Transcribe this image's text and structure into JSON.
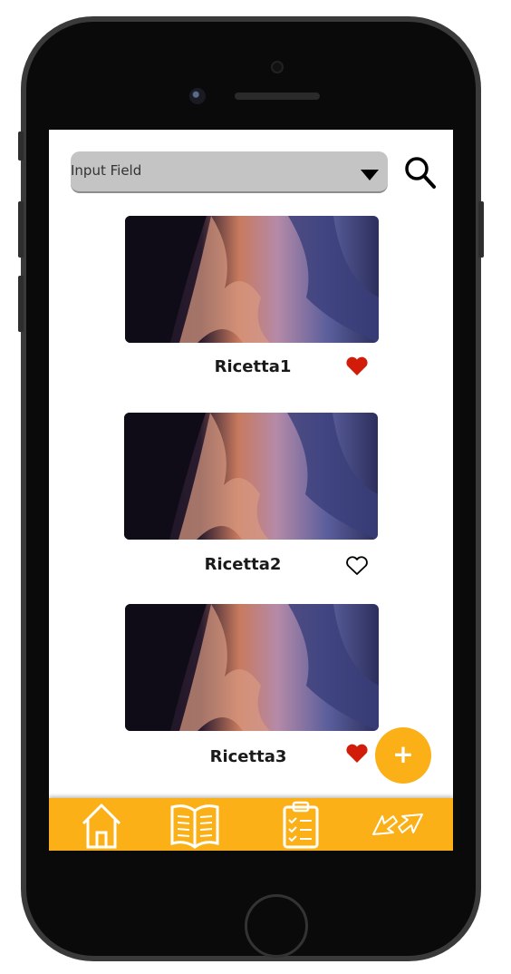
{
  "search": {
    "placeholder": "Input Field"
  },
  "recipes": [
    {
      "title": "Ricetta1",
      "favorite": true
    },
    {
      "title": "Ricetta2",
      "favorite": false
    },
    {
      "title": "Ricetta3",
      "favorite": true
    }
  ],
  "fab": {
    "label": "+"
  },
  "colors": {
    "accent": "#fcb017",
    "heart": "#d21c0a",
    "field": "#c4c4c4"
  },
  "icons": [
    "search-icon",
    "chevron-down-icon",
    "heart-icon",
    "home-icon",
    "book-icon",
    "clipboard-list-icon",
    "swap-arrows-icon"
  ]
}
